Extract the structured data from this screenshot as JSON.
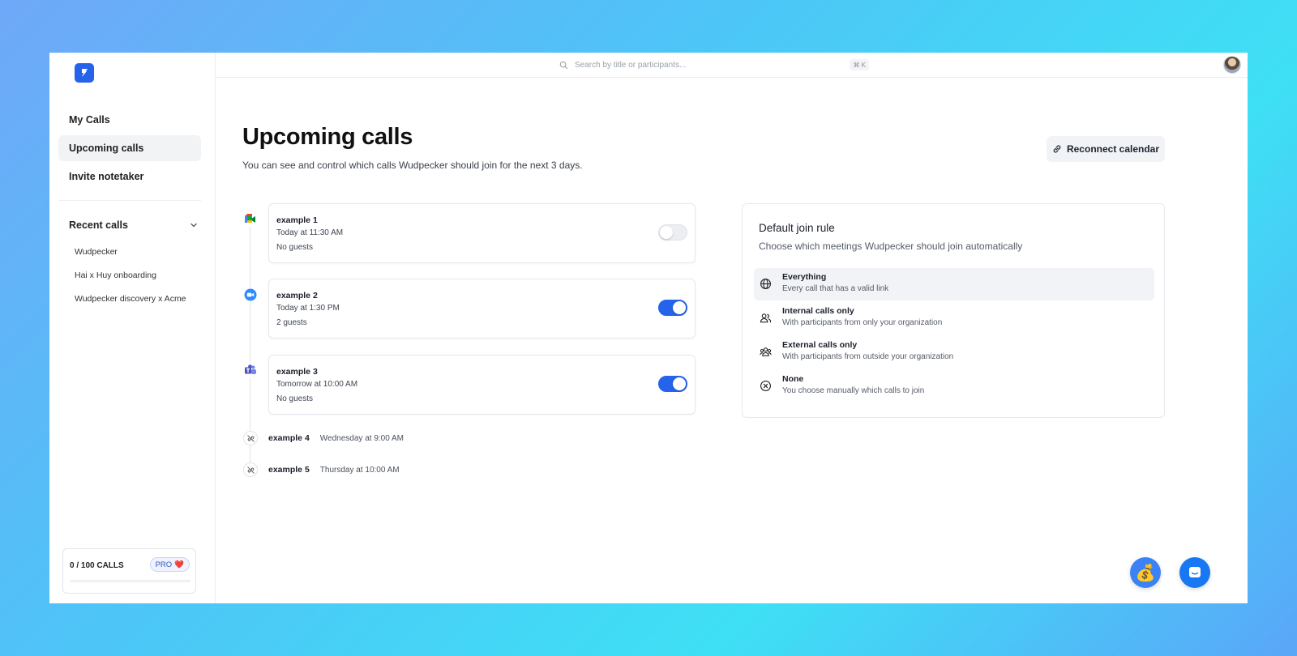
{
  "app": {
    "logo_glyph": "⚡"
  },
  "sidebar": {
    "nav": [
      {
        "label": "My Calls"
      },
      {
        "label": "Upcoming calls",
        "active": true
      },
      {
        "label": "Invite notetaker"
      }
    ],
    "recent_heading": "Recent calls",
    "recent": [
      "Wudpecker",
      "Hai x Huy onboarding",
      "Wudpecker discovery x Acme"
    ],
    "usage": {
      "label": "0 / 100 CALLS",
      "badge": "PRO",
      "badge_emoji": "❤️",
      "progress": 0
    }
  },
  "topbar": {
    "search_placeholder": "Search by title or participants...",
    "shortcut": "⌘ K"
  },
  "main": {
    "title": "Upcoming calls",
    "subtitle": "You can see and control which calls Wudpecker should join for the next 3 days.",
    "reconnect_label": "Reconnect calendar",
    "calls": [
      {
        "title": "example 1",
        "time": "Today at 11:30 AM",
        "guests": "No guests",
        "platform": "google-meet",
        "enabled": false
      },
      {
        "title": "example 2",
        "time": "Today at 1:30 PM",
        "guests": "2 guests",
        "platform": "zoom",
        "enabled": true
      },
      {
        "title": "example 3",
        "time": "Tomorrow at 10:00 AM",
        "guests": "No guests",
        "platform": "teams",
        "enabled": true
      }
    ],
    "unlinked_calls": [
      {
        "title": "example 4",
        "time": "Wednesday at 9:00 AM"
      },
      {
        "title": "example 5",
        "time": "Thursday at 10:00 AM"
      }
    ]
  },
  "join_rule": {
    "title": "Default join rule",
    "subtitle": "Choose which meetings Wudpecker should join automatically",
    "options": [
      {
        "title": "Everything",
        "desc": "Every call that has a valid link",
        "icon": "globe-icon",
        "selected": true
      },
      {
        "title": "Internal calls only",
        "desc": "With participants from only your organization",
        "icon": "users-icon"
      },
      {
        "title": "External calls only",
        "desc": "With participants from outside your organization",
        "icon": "group-icon"
      },
      {
        "title": "None",
        "desc": "You choose manually which calls to join",
        "icon": "x-circle-icon"
      }
    ]
  },
  "fabs": {
    "money_emoji": "💰"
  },
  "colors": {
    "accent": "#2563eb",
    "background_gradient": [
      "#6fa8f8",
      "#3ee0f5"
    ]
  }
}
